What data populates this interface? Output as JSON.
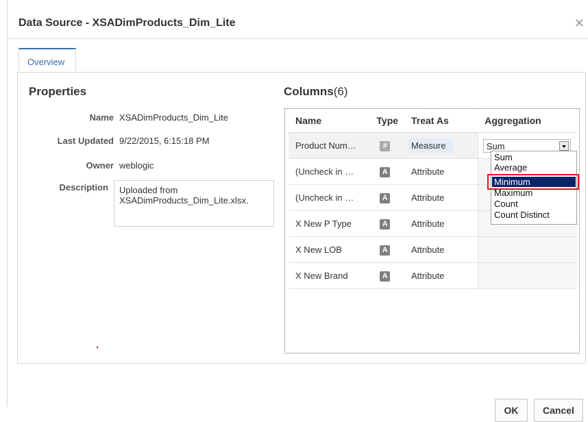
{
  "dialog": {
    "title": "Data Source - XSADimProducts_Dim_Lite",
    "close_icon": "close-icon"
  },
  "tabs": [
    {
      "label": "Overview",
      "active": true
    }
  ],
  "properties": {
    "heading": "Properties",
    "name_label": "Name",
    "name_value": "XSADimProducts_Dim_Lite",
    "last_updated_label": "Last Updated",
    "last_updated_value": "9/22/2015, 6:15:18 PM",
    "owner_label": "Owner",
    "owner_value": "weblogic",
    "description_label": "Description",
    "description_line1": "Uploaded from",
    "description_line2": "XSADimProducts_Dim_Lite.xlsx."
  },
  "columns": {
    "heading": "Columns",
    "count": "(6)",
    "headers": {
      "name": "Name",
      "type": "Type",
      "treat_as": "Treat As",
      "aggregation": "Aggregation"
    },
    "rows": [
      {
        "name": "Product Num…",
        "type_icon": "#",
        "treat_as": "Measure",
        "aggregation": "Sum"
      },
      {
        "name": "(Uncheck in …",
        "type_icon": "A",
        "treat_as": "Attribute",
        "aggregation": ""
      },
      {
        "name": "(Uncheck in …",
        "type_icon": "A",
        "treat_as": "Attribute",
        "aggregation": ""
      },
      {
        "name": "X New P Type",
        "type_icon": "A",
        "treat_as": "Attribute",
        "aggregation": ""
      },
      {
        "name": "X New LOB",
        "type_icon": "A",
        "treat_as": "Attribute",
        "aggregation": ""
      },
      {
        "name": "X New Brand",
        "type_icon": "A",
        "treat_as": "Attribute",
        "aggregation": ""
      }
    ]
  },
  "aggregation_dropdown": {
    "selected": "Minimum",
    "options": [
      "Sum",
      "Average",
      "Minimum",
      "Maximum",
      "Count",
      "Count Distinct"
    ]
  },
  "buttons": {
    "ok": "OK",
    "cancel": "Cancel"
  },
  "colors": {
    "accent": "#3a6ea5",
    "selected_option": "#0a2468",
    "highlight": "#e0141b"
  }
}
